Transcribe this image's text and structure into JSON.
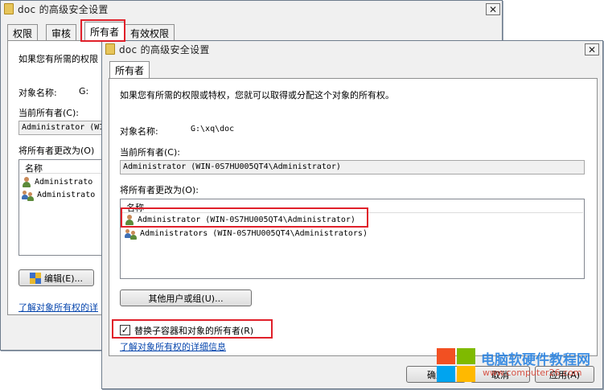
{
  "back_window": {
    "title": "doc 的高级安全设置",
    "tabs": [
      "权限",
      "审核",
      "所有者",
      "有效权限"
    ],
    "intro": "如果您有所需的权限",
    "object_label": "对象名称:",
    "object_value": "G:",
    "current_owner_label": "当前所有者(C):",
    "current_owner_value": "Administrator (WI",
    "change_owner_label": "将所有者更改为(O)",
    "list_header": "名称",
    "list_items": [
      "Administrato",
      "Administrato"
    ],
    "edit_button": "编辑(E)...",
    "learn_link": "了解对象所有权的详"
  },
  "front_window": {
    "title": "doc 的高级安全设置",
    "tab": "所有者",
    "intro": "如果您有所需的权限或特权，您就可以取得或分配这个对象的所有权。",
    "object_label": "对象名称:",
    "object_value": "G:\\xq\\doc",
    "current_owner_label": "当前所有者(C):",
    "current_owner_value": "Administrator (WIN-0S7HU005QT4\\Administrator)",
    "change_owner_label": "将所有者更改为(O):",
    "list_header": "名称",
    "list_items": [
      "Administrator (WIN-0S7HU005QT4\\Administrator)",
      "Administrators (WIN-0S7HU005QT4\\Administrators)"
    ],
    "other_users_button": "其他用户或组(U)...",
    "replace_checkbox_label": "替换子容器和对象的所有者(R)",
    "replace_checked": true,
    "check_mark": "✓",
    "learn_link": "了解对象所有权的详细信息",
    "ok_button": "确定",
    "cancel_button": "取消",
    "apply_button": "应用(A)"
  },
  "close_glyph": "✕",
  "watermark": {
    "text": "电脑软硬件教程网",
    "url": "www.computer26.com"
  },
  "colors": {
    "highlight": "#e0202a",
    "link": "#0645ad",
    "window_bg": "#f0f0f0"
  }
}
